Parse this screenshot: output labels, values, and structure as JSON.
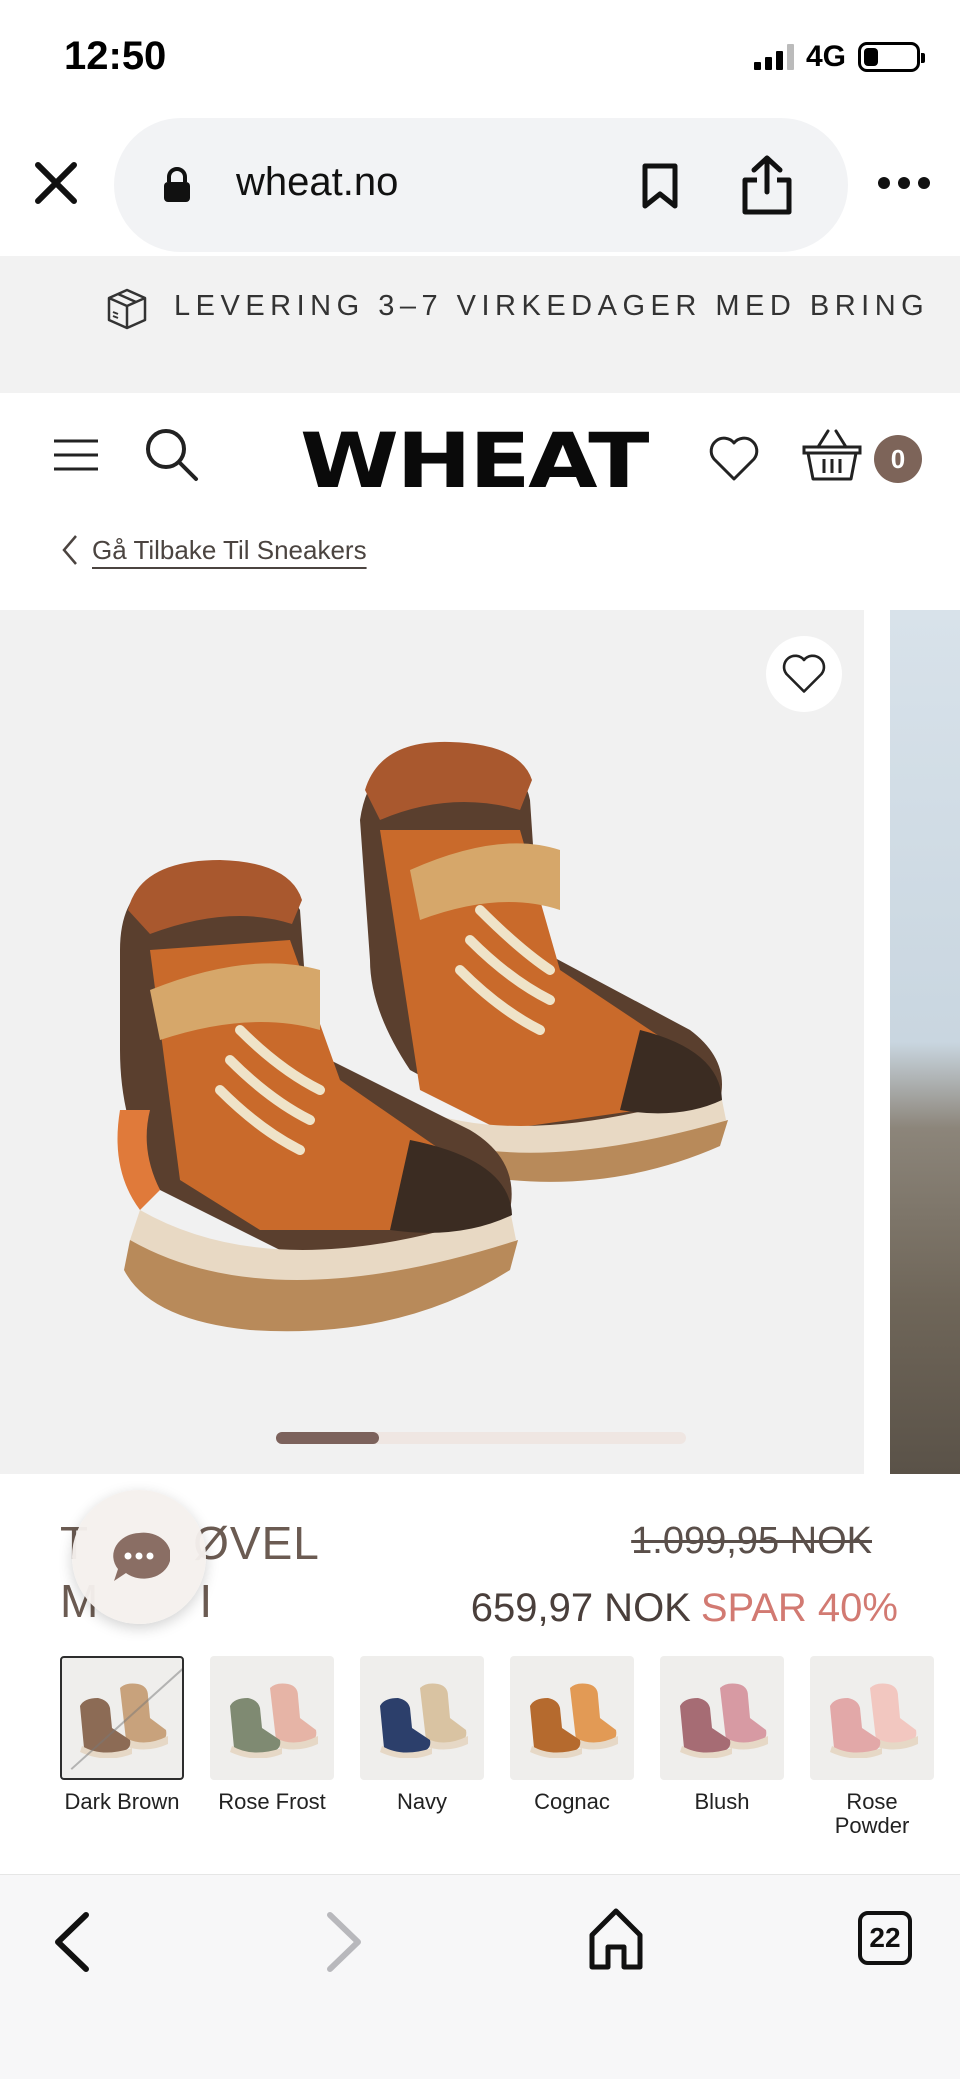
{
  "status_bar": {
    "time": "12:50",
    "network": "4G"
  },
  "browser": {
    "url": "wheat.no"
  },
  "banner": {
    "text": "LEVERING 3–7 VIRKEDAGER MED BRING"
  },
  "header": {
    "logo": "WHEAT",
    "cart_count": "0"
  },
  "breadcrumb": {
    "back_label": "Gå Tilbake Til Sneakers"
  },
  "gallery": {
    "progress": 0.25
  },
  "product": {
    "title_line1": "T",
    "title_line1_end": "ØVEL",
    "title_line2": "M",
    "title_line2_end": "I",
    "old_price": "1.099,95 NOK",
    "new_price": "659,97 NOK",
    "save_label": "SPAR 40%"
  },
  "swatches": [
    {
      "label": "Dark Brown",
      "colors": [
        "#8c6b55",
        "#c8a27c"
      ],
      "selected": true
    },
    {
      "label": "Rose Frost",
      "colors": [
        "#7f8a72",
        "#e6b4a6"
      ],
      "selected": false
    },
    {
      "label": "Navy",
      "colors": [
        "#2c3f6b",
        "#d9c3a2"
      ],
      "selected": false
    },
    {
      "label": "Cognac",
      "colors": [
        "#b56a2e",
        "#e29a55"
      ],
      "selected": false
    },
    {
      "label": "Blush",
      "colors": [
        "#a66c74",
        "#d79aa3"
      ],
      "selected": false
    },
    {
      "label": "Rose\nPowder",
      "colors": [
        "#e2a8a8",
        "#f2c7c0"
      ],
      "selected": false
    }
  ],
  "toolbar": {
    "tabs_count": "22"
  },
  "colors": {
    "accent": "#7d6459",
    "sale": "#d27a72",
    "banner_bg": "#f2f2f2"
  }
}
